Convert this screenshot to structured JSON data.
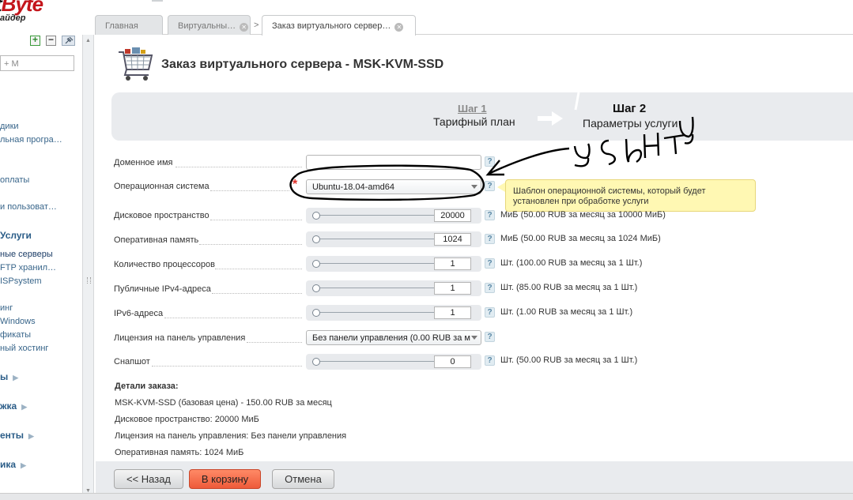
{
  "logo": {
    "text_part1": "t",
    "text_part2": "Byte",
    "subtitle": "айдер"
  },
  "sidebar": {
    "tools": [
      "plus-icon",
      "minus-icon",
      "pin-icon"
    ],
    "search_text": "+ M",
    "items": [
      {
        "label": "дики",
        "section": false
      },
      {
        "label": "льная програ…",
        "section": false
      },
      {
        "label": "оплаты",
        "section": false
      },
      {
        "label": "и пользоват…",
        "section": false
      },
      {
        "label": "Услуги",
        "section": true
      },
      {
        "label": "ные серверы",
        "section": false,
        "active": true
      },
      {
        "label": "FTP хранил…",
        "section": false
      },
      {
        "label": "ISPsystem",
        "section": false
      },
      {
        "label": "инг",
        "section": false
      },
      {
        "label": "Windows",
        "section": false
      },
      {
        "label": "фикаты",
        "section": false
      },
      {
        "label": "ный хостинг",
        "section": false
      },
      {
        "label": "ы",
        "section": true
      },
      {
        "label": "жка",
        "section": true
      },
      {
        "label": "енты",
        "section": true
      },
      {
        "label": "ика",
        "section": true
      }
    ]
  },
  "tabs": [
    {
      "label": "Главная"
    },
    {
      "label": "Виртуальны…"
    },
    {
      "label": "Заказ виртуального сервер…"
    }
  ],
  "page": {
    "title": "Заказ виртуального сервера - MSK-KVM-SSD",
    "icon": "shopping-cart-icon"
  },
  "steps": {
    "step1": {
      "title": "Шаг 1",
      "subtitle": "Тарифный план"
    },
    "step2": {
      "title": "Шаг 2",
      "subtitle": "Параметры услуги"
    }
  },
  "form": {
    "domain_label": "Доменное имя",
    "domain_value": "",
    "os_label": "Операционная система",
    "os_value": "Ubuntu-18.04-amd64",
    "os_tooltip_line1": "Шаблон операционной системы, который будет",
    "os_tooltip_line2": "установлен при обработке услуги",
    "disk_label": "Дисковое пространство",
    "disk_value": "20000",
    "disk_hint": "МиБ (50.00 RUB за месяц за 10000 МиБ)",
    "ram_label": "Оперативная память",
    "ram_value": "1024",
    "ram_hint": "МиБ (50.00 RUB за месяц за 1024 МиБ)",
    "cpu_label": "Количество процессоров",
    "cpu_value": "1",
    "cpu_hint": "Шт. (100.00 RUB за месяц за 1 Шт.)",
    "ipv4_label": "Публичные IPv4-адреса",
    "ipv4_value": "1",
    "ipv4_hint": "Шт. (85.00 RUB за месяц за 1 Шт.)",
    "ipv6_label": "IPv6-адреса",
    "ipv6_value": "1",
    "ipv6_hint": "Шт. (1.00 RUB за месяц за 1 Шт.)",
    "license_label": "Лицензия на панель управления",
    "license_value": "Без панели управления (0.00 RUB за м",
    "snapshot_label": "Снапшот",
    "snapshot_value": "0",
    "snapshot_hint": "Шт. (50.00 RUB за месяц за 1 Шт.)",
    "help_glyph": "?"
  },
  "details": {
    "heading": "Детали заказа:",
    "lines": [
      "MSK-KVM-SSD (базовая цена) - 150.00 RUB за месяц",
      "Дисковое пространство: 20000 МиБ",
      "Лицензия на панель управления: Без панели управления",
      "Оперативная память: 1024 МиБ"
    ]
  },
  "buttons": {
    "back": "<< Назад",
    "cart": "В корзину",
    "cancel": "Отмена"
  },
  "colors": {
    "accent": "#ee5a3a",
    "link": "#38658a",
    "tooltip": "#fff8b3"
  }
}
